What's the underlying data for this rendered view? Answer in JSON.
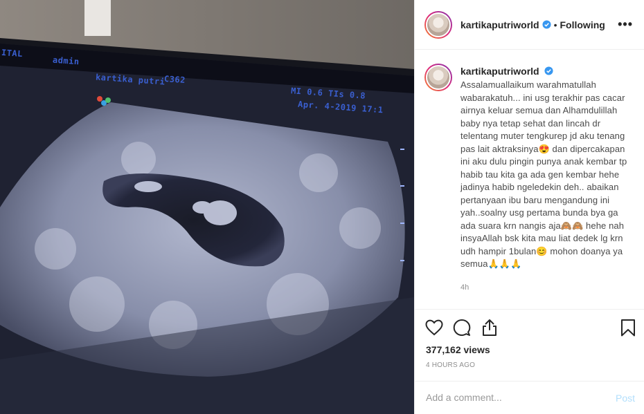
{
  "header": {
    "username": "kartikaputriworld",
    "separator": "•",
    "follow_status": "Following",
    "more_label": "•••"
  },
  "media": {
    "osd_ital": "ITAL",
    "osd_user": "admin",
    "osd_patient": "kartika putri",
    "osd_code": "C362",
    "osd_mi": "MI 0.6  TIs 0.8",
    "osd_date": "Apr. 4-2019  17:1"
  },
  "caption": {
    "username": "kartikaputriworld",
    "text": "Assalamuallaikum warahmatullah wabarakatuh... ini usg terakhir pas cacar airnya keluar semua dan Alhamdulillah baby nya tetap sehat dan lincah dr telentang muter tengkurep jd aku tenang pas lait aktraksinya😍 dan dipercakapan ini aku dulu pingin punya anak kembar tp habib tau kita ga ada gen kembar hehe jadinya habib ngeledekin deh.. abaikan pertanyaan ibu baru mengandung ini yah..soalny usg pertama bunda bya ga ada suara krn nangis aja🙈🙈 hehe nah insyaAllah bsk kita mau liat dedek lg krn udh hampir 1bulan😊 mohon doanya ya semua🙏🙏🙏",
    "time": "4h"
  },
  "stats": {
    "views": "377,162 views",
    "time_ago": "4 HOURS AGO"
  },
  "comment": {
    "placeholder": "Add a comment...",
    "post_label": "Post"
  },
  "icons": {
    "like": "heart-icon",
    "comment": "comment-icon",
    "share": "share-icon",
    "save": "bookmark-icon",
    "verified": "verified-badge-icon"
  },
  "colors": {
    "verified": "#3897f0",
    "post_disabled": "#b2dffc",
    "screen_text": "#3a5fd0"
  }
}
